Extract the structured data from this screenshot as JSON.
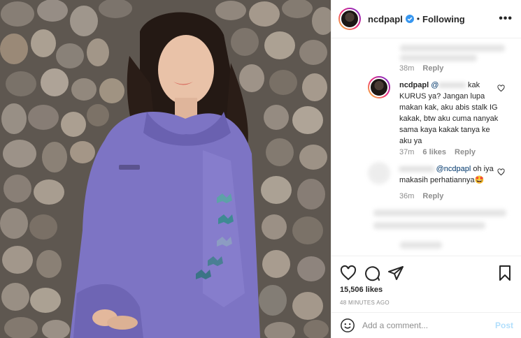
{
  "post": {
    "image_icon": "photo",
    "header": {
      "username": "ncdpapl",
      "verified_icon": "verified-badge-icon",
      "dot": "•",
      "following": "Following",
      "more": "•••"
    },
    "comments": {
      "c1": {
        "time": "38m",
        "reply": "Reply"
      },
      "c2": {
        "username": "ncdpapl",
        "mention": "@",
        "text_line1": "kak",
        "text_rest": "KURUS ya? Jangan lupa makan kak, aku abis stalk IG kakak, btw aku cuma nanyak sama kaya kakak tanya ke aku ya",
        "time": "37m",
        "likes": "6 likes",
        "reply": "Reply"
      },
      "c3": {
        "mention": "@ncdpapl",
        "text": "oh iya makasih perhatiannya",
        "emoji": "🤩",
        "time": "36m",
        "reply": "Reply"
      }
    },
    "actions": {
      "likes": "15,506 likes",
      "timestamp": "48 MINUTES AGO"
    },
    "add_comment": {
      "placeholder": "Add a comment...",
      "post": "Post"
    }
  },
  "colors": {
    "accent_blue": "#0095f6",
    "post_disabled": "#b2dffc",
    "meta_gray": "#8e8e8e",
    "hoodie": "#7d74c4"
  }
}
